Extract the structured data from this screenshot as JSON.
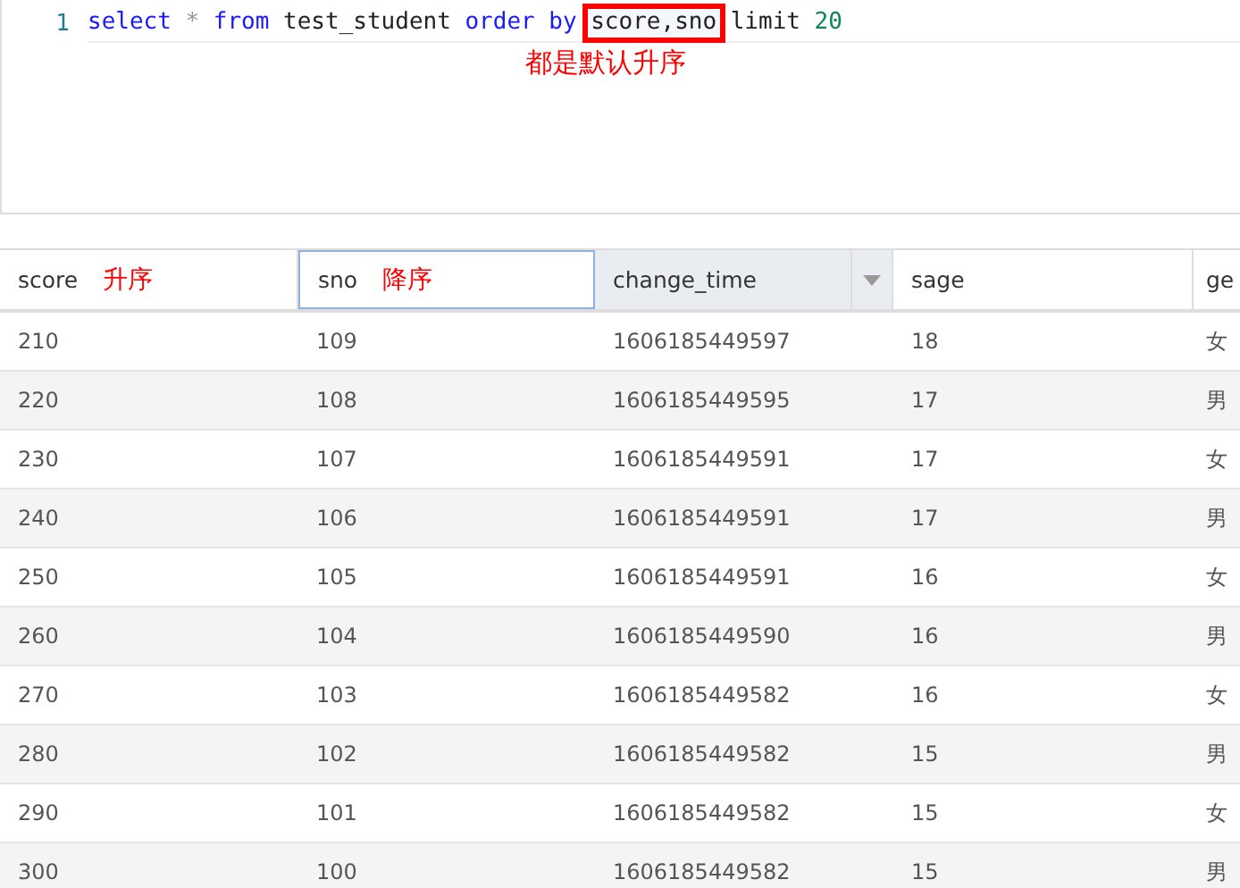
{
  "editor": {
    "lines": [
      {
        "number": "1",
        "tokens": [
          {
            "kind": "keyword",
            "text": "select"
          },
          {
            "kind": "operator",
            "text": "*"
          },
          {
            "kind": "keyword",
            "text": "from"
          },
          {
            "kind": "plain",
            "text": "test_student"
          },
          {
            "kind": "keyword",
            "text": "order"
          },
          {
            "kind": "keyword",
            "text": "by"
          },
          {
            "kind": "boxed",
            "text": "score,sno"
          },
          {
            "kind": "plain",
            "text": "limit"
          },
          {
            "kind": "number",
            "text": "20"
          }
        ]
      }
    ],
    "annotation": "都是默认升序"
  },
  "table": {
    "columns": [
      {
        "label": "score",
        "note": "升序",
        "focused": false,
        "hovered": false
      },
      {
        "label": "sno",
        "note": "降序",
        "focused": true,
        "hovered": false
      },
      {
        "label": "change_time",
        "focused": false,
        "hovered": true
      },
      {
        "label": "sage",
        "focused": false,
        "hovered": false
      },
      {
        "label": "ge",
        "focused": false,
        "hovered": false
      }
    ],
    "rows": [
      [
        "210",
        "109",
        "1606185449597",
        "18",
        "女"
      ],
      [
        "220",
        "108",
        "1606185449595",
        "17",
        "男"
      ],
      [
        "230",
        "107",
        "1606185449591",
        "17",
        "女"
      ],
      [
        "240",
        "106",
        "1606185449591",
        "17",
        "男"
      ],
      [
        "250",
        "105",
        "1606185449591",
        "16",
        "女"
      ],
      [
        "260",
        "104",
        "1606185449590",
        "16",
        "男"
      ],
      [
        "270",
        "103",
        "1606185449582",
        "16",
        "女"
      ],
      [
        "280",
        "102",
        "1606185449582",
        "15",
        "男"
      ],
      [
        "290",
        "101",
        "1606185449582",
        "15",
        "女"
      ],
      [
        "300",
        "100",
        "1606185449582",
        "15",
        "男"
      ]
    ]
  }
}
